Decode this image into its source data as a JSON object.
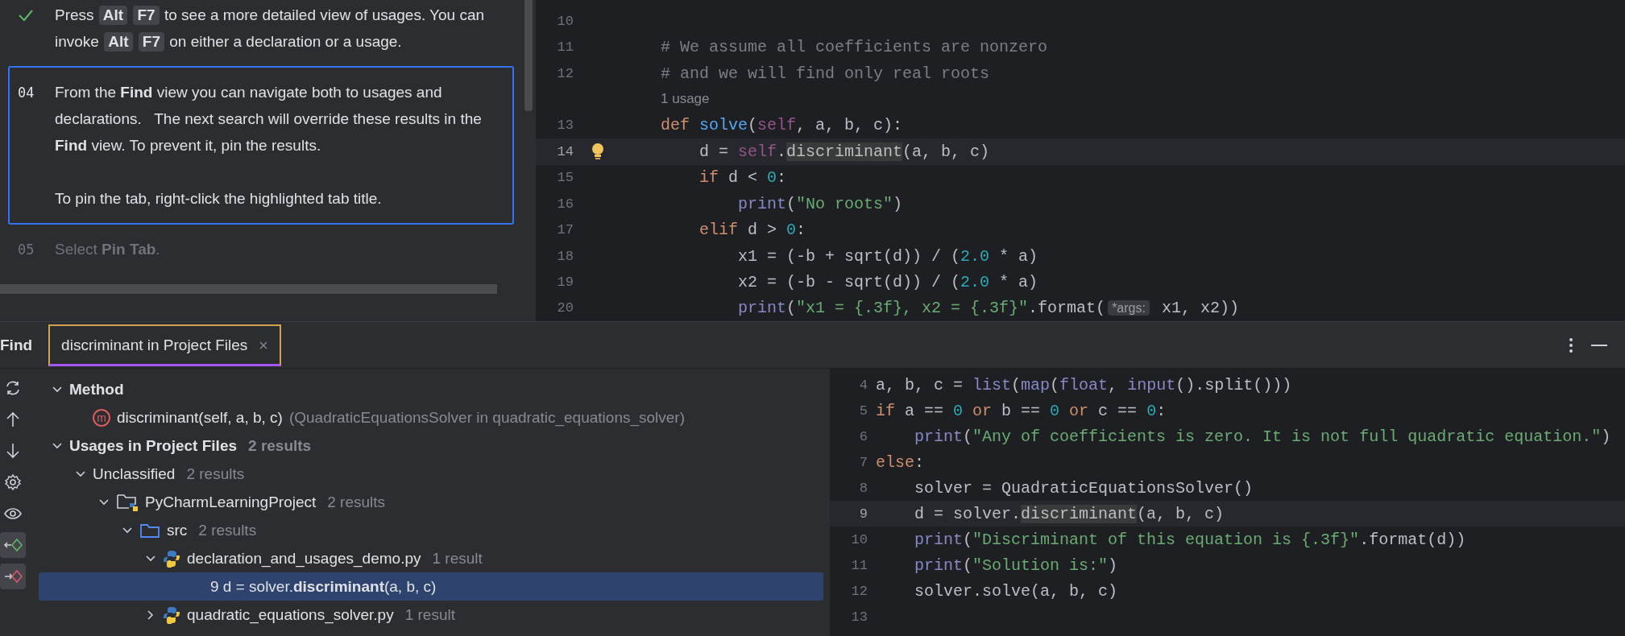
{
  "tutorial": {
    "steps": [
      {
        "kind": "done",
        "paragraphs": [
          [
            {
              "kind": "text",
              "text": "Press"
            },
            {
              "kind": "key",
              "text": "Alt"
            },
            {
              "kind": "key",
              "text": "F7"
            },
            {
              "kind": "text",
              "text": "to see a more detailed view of usages. You can"
            },
            {
              "kind": "text",
              "text": "invoke"
            },
            {
              "kind": "key",
              "text": "Alt"
            },
            {
              "kind": "key",
              "text": "F7"
            },
            {
              "kind": "text",
              "text": "on either a declaration or a usage."
            }
          ]
        ]
      },
      {
        "kind": "active",
        "number": "04",
        "paragraphs": [
          [
            {
              "kind": "text",
              "text": "From the **Find** view you can navigate both to usages and declarations.   The next search will override these results in the **Find** view. To prevent it, pin the results."
            }
          ],
          [
            {
              "kind": "text",
              "text": "To pin the tab, right-click the highlighted tab title."
            }
          ]
        ]
      },
      {
        "kind": "pending",
        "number": "05",
        "paragraphs": [
          [
            {
              "kind": "text",
              "text": "Select **Pin Tab**."
            }
          ]
        ]
      }
    ]
  },
  "editor": {
    "lines": [
      {
        "kind": "code",
        "number": "10",
        "current": false,
        "bulb": false
      },
      {
        "kind": "code",
        "number": "11",
        "current": false,
        "bulb": false,
        "tokens": [
          {
            "kind": "comment",
            "text": "    # We assume all coefficients are nonzero"
          }
        ]
      },
      {
        "kind": "code",
        "number": "12",
        "current": false,
        "bulb": false,
        "tokens": [
          {
            "kind": "comment",
            "text": "    # and we will find only real roots"
          }
        ]
      },
      {
        "kind": "usage",
        "text": "1 usage"
      },
      {
        "kind": "code",
        "number": "13",
        "current": false,
        "bulb": false,
        "tokens": [
          {
            "kind": "kw",
            "text": "    def "
          },
          {
            "kind": "fn",
            "text": "solve"
          },
          {
            "kind": "plain",
            "text": "("
          },
          {
            "kind": "self",
            "text": "self"
          },
          {
            "kind": "plain",
            "text": ", a, b, c):"
          }
        ]
      },
      {
        "kind": "code",
        "number": "14",
        "current": true,
        "bulb": true,
        "tokens": [
          {
            "kind": "plain",
            "text": "        d = "
          },
          {
            "kind": "self",
            "text": "self"
          },
          {
            "kind": "plain",
            "text": "."
          },
          {
            "kind": "ref",
            "text": "discriminant"
          },
          {
            "kind": "plain",
            "text": "(a, b, c)"
          }
        ]
      },
      {
        "kind": "code",
        "number": "15",
        "current": false,
        "bulb": false,
        "tokens": [
          {
            "kind": "kw",
            "text": "        if "
          },
          {
            "kind": "plain",
            "text": "d < "
          },
          {
            "kind": "num",
            "text": "0"
          },
          {
            "kind": "plain",
            "text": ":"
          }
        ]
      },
      {
        "kind": "code",
        "number": "16",
        "current": false,
        "bulb": false,
        "tokens": [
          {
            "kind": "builtin",
            "text": "            print"
          },
          {
            "kind": "plain",
            "text": "("
          },
          {
            "kind": "str",
            "text": "\"No roots\""
          },
          {
            "kind": "plain",
            "text": ")"
          }
        ]
      },
      {
        "kind": "code",
        "number": "17",
        "current": false,
        "bulb": false,
        "tokens": [
          {
            "kind": "kw",
            "text": "        elif "
          },
          {
            "kind": "plain",
            "text": "d > "
          },
          {
            "kind": "num",
            "text": "0"
          },
          {
            "kind": "plain",
            "text": ":"
          }
        ]
      },
      {
        "kind": "code",
        "number": "18",
        "current": false,
        "bulb": false,
        "tokens": [
          {
            "kind": "plain",
            "text": "            x1 = (-b + sqrt(d)) / ("
          },
          {
            "kind": "num",
            "text": "2.0"
          },
          {
            "kind": "plain",
            "text": " * a)"
          }
        ]
      },
      {
        "kind": "code",
        "number": "19",
        "current": false,
        "bulb": false,
        "tokens": [
          {
            "kind": "plain",
            "text": "            x2 = (-b - sqrt(d)) / ("
          },
          {
            "kind": "num",
            "text": "2.0"
          },
          {
            "kind": "plain",
            "text": " * a)"
          }
        ]
      },
      {
        "kind": "code",
        "number": "20",
        "current": false,
        "bulb": false,
        "tokens": [
          {
            "kind": "builtin",
            "text": "            print"
          },
          {
            "kind": "plain",
            "text": "("
          },
          {
            "kind": "str",
            "text": "\"x1 = {.3f}, x2 = {.3f}\""
          },
          {
            "kind": "plain",
            "text": ".format("
          },
          {
            "kind": "hint",
            "text": "*args:"
          },
          {
            "kind": "plain",
            "text": " x1, x2))"
          }
        ]
      }
    ]
  },
  "find": {
    "title": "Find",
    "tabs": [
      {
        "label": "discriminant in Project Files",
        "selected": true
      }
    ],
    "toolbar": [
      {
        "kind": "refresh",
        "on": false
      },
      {
        "kind": "up",
        "on": false
      },
      {
        "kind": "down",
        "on": false
      },
      {
        "kind": "settings",
        "on": false
      },
      {
        "kind": "eye",
        "on": false
      },
      {
        "kind": "merge-in",
        "on": true
      },
      {
        "kind": "merge-out",
        "on": true
      }
    ],
    "tree": [
      {
        "kind": "group",
        "label": "Method",
        "selected": false,
        "expanded": true,
        "children": [
          {
            "kind": "method",
            "badge": "m",
            "label": "discriminant(self, a, b, c)",
            "note": "(QuadraticEquationsSolver in quadratic_equations_solver)",
            "selected": false
          }
        ]
      },
      {
        "kind": "group",
        "label": "Usages in Project Files",
        "count": "2 results",
        "selected": false,
        "expanded": true,
        "children": [
          {
            "kind": "plain",
            "label": "Unclassified",
            "count": "2 results",
            "selected": false,
            "expanded": true,
            "children": [
              {
                "kind": "project",
                "label": "PyCharmLearningProject",
                "count": "2 results",
                "selected": false,
                "expanded": true,
                "children": [
                  {
                    "kind": "folder",
                    "label": "src",
                    "count": "2 results",
                    "selected": false,
                    "expanded": true,
                    "children": [
                      {
                        "kind": "python",
                        "label": "declaration_and_usages_demo.py",
                        "count": "1 result",
                        "selected": false,
                        "expanded": true,
                        "children": [
                          {
                            "kind": "usage",
                            "label": "9 d = solver.**discriminant**(a, b, c)",
                            "selected": true
                          }
                        ]
                      },
                      {
                        "kind": "python",
                        "label": "quadratic_equations_solver.py",
                        "count": "1 result",
                        "selected": false,
                        "expanded": false
                      }
                    ]
                  }
                ]
              }
            ]
          }
        ]
      }
    ]
  },
  "preview": {
    "lines": [
      {
        "number": "4",
        "current": false,
        "tokens": [
          {
            "kind": "plain",
            "text": "a, b, c = "
          },
          {
            "kind": "builtin",
            "text": "list"
          },
          {
            "kind": "plain",
            "text": "("
          },
          {
            "kind": "builtin",
            "text": "map"
          },
          {
            "kind": "plain",
            "text": "("
          },
          {
            "kind": "builtin",
            "text": "float"
          },
          {
            "kind": "plain",
            "text": ", "
          },
          {
            "kind": "builtin",
            "text": "input"
          },
          {
            "kind": "plain",
            "text": "().split()))"
          }
        ]
      },
      {
        "number": "5",
        "current": false,
        "tokens": [
          {
            "kind": "kw",
            "text": "if "
          },
          {
            "kind": "plain",
            "text": "a == "
          },
          {
            "kind": "num",
            "text": "0"
          },
          {
            "kind": "kw",
            "text": " or "
          },
          {
            "kind": "plain",
            "text": "b == "
          },
          {
            "kind": "num",
            "text": "0"
          },
          {
            "kind": "kw",
            "text": " or "
          },
          {
            "kind": "plain",
            "text": "c == "
          },
          {
            "kind": "num",
            "text": "0"
          },
          {
            "kind": "plain",
            "text": ":"
          }
        ]
      },
      {
        "number": "6",
        "current": false,
        "tokens": [
          {
            "kind": "builtin",
            "text": "    print"
          },
          {
            "kind": "plain",
            "text": "("
          },
          {
            "kind": "str",
            "text": "\"Any of coefficients is zero. It is not full quadratic equation.\""
          },
          {
            "kind": "plain",
            "text": ")"
          }
        ]
      },
      {
        "number": "7",
        "current": false,
        "tokens": [
          {
            "kind": "kw",
            "text": "else"
          },
          {
            "kind": "plain",
            "text": ":"
          }
        ]
      },
      {
        "number": "8",
        "current": false,
        "tokens": [
          {
            "kind": "plain",
            "text": "    solver = QuadraticEquationsSolver()"
          }
        ]
      },
      {
        "number": "9",
        "current": true,
        "tokens": [
          {
            "kind": "plain",
            "text": "    d = solver."
          },
          {
            "kind": "ref",
            "text": "discriminant"
          },
          {
            "kind": "plain",
            "text": "(a, b, c)"
          }
        ]
      },
      {
        "number": "10",
        "current": false,
        "tokens": [
          {
            "kind": "builtin",
            "text": "    print"
          },
          {
            "kind": "plain",
            "text": "("
          },
          {
            "kind": "str",
            "text": "\"Discriminant of this equation is {.3f}\""
          },
          {
            "kind": "plain",
            "text": ".format(d))"
          }
        ]
      },
      {
        "number": "11",
        "current": false,
        "tokens": [
          {
            "kind": "builtin",
            "text": "    print"
          },
          {
            "kind": "plain",
            "text": "("
          },
          {
            "kind": "str",
            "text": "\"Solution is:\""
          },
          {
            "kind": "plain",
            "text": ")"
          }
        ]
      },
      {
        "number": "12",
        "current": false,
        "tokens": [
          {
            "kind": "plain",
            "text": "    solver.solve(a, b, c)"
          }
        ]
      },
      {
        "number": "13",
        "current": false
      }
    ]
  }
}
